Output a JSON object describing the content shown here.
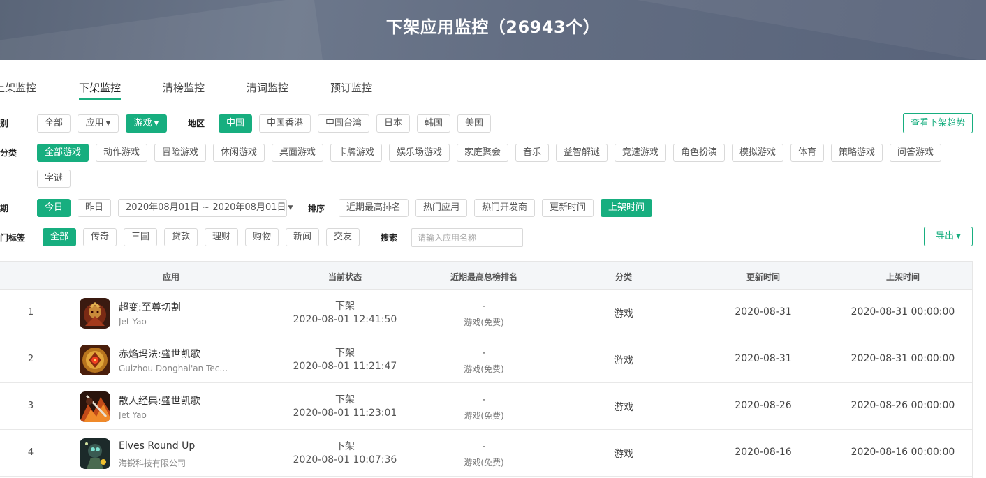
{
  "header": {
    "title": "下架应用监控（26943个）"
  },
  "tabs": [
    "上架监控",
    "下架监控",
    "清榜监控",
    "清词监控",
    "预订监控"
  ],
  "filters": {
    "category": {
      "label": "类别",
      "options": [
        "全部",
        "应用",
        "游戏"
      ],
      "selected": "游戏"
    },
    "region": {
      "label": "地区",
      "options": [
        "中国",
        "中国香港",
        "中国台湾",
        "日本",
        "韩国",
        "美国"
      ],
      "selected": "中国"
    },
    "trend_button": "查看下架趋势",
    "subcategory": {
      "label": "子分类",
      "options": [
        "全部游戏",
        "动作游戏",
        "冒险游戏",
        "休闲游戏",
        "桌面游戏",
        "卡牌游戏",
        "娱乐场游戏",
        "家庭聚会",
        "音乐",
        "益智解谜",
        "竞速游戏",
        "角色扮演",
        "模拟游戏",
        "体育",
        "策略游戏",
        "问答游戏",
        "字谜"
      ],
      "selected": "全部游戏"
    },
    "date": {
      "label": "日期",
      "options": [
        "今日",
        "昨日"
      ],
      "selected": "今日",
      "range": "2020年08月01日 ~ 2020年08月01日"
    },
    "sort": {
      "label": "排序",
      "options": [
        "近期最高排名",
        "热门应用",
        "热门开发商",
        "更新时间",
        "上架时间"
      ],
      "selected": "上架时间"
    },
    "tags": {
      "label": "热门标签",
      "options": [
        "全部",
        "传奇",
        "三国",
        "贷款",
        "理财",
        "购物",
        "新闻",
        "交友"
      ],
      "selected": "全部"
    },
    "search": {
      "label": "搜索",
      "placeholder": "请输入应用名称",
      "value": ""
    },
    "export_button": "导出"
  },
  "table": {
    "columns": [
      "应用",
      "当前状态",
      "近期最高总榜排名",
      "分类",
      "更新时间",
      "上架时间"
    ],
    "rows": [
      {
        "index": "1",
        "name": "超变:至尊切割",
        "developer": "Jet Yao",
        "status": "下架",
        "status_time": "2020-08-01 12:41:50",
        "rank": "-",
        "rank_sub": "游戏(免费)",
        "category": "游戏",
        "updated": "2020-08-31",
        "listed": "2020-08-31 00:00:00",
        "icon": "app-icon-warrior"
      },
      {
        "index": "2",
        "name": "赤焰玛法:盛世凯歌",
        "developer": "Guizhou Donghai'an Techn...",
        "status": "下架",
        "status_time": "2020-08-01 11:21:47",
        "rank": "-",
        "rank_sub": "游戏(免费)",
        "category": "游戏",
        "updated": "2020-08-31",
        "listed": "2020-08-31 00:00:00",
        "icon": "app-icon-emblem"
      },
      {
        "index": "3",
        "name": "散人经典:盛世凯歌",
        "developer": "Jet Yao",
        "status": "下架",
        "status_time": "2020-08-01 11:23:01",
        "rank": "-",
        "rank_sub": "游戏(免费)",
        "category": "游戏",
        "updated": "2020-08-26",
        "listed": "2020-08-26 00:00:00",
        "icon": "app-icon-fire-blade"
      },
      {
        "index": "4",
        "name": "Elves Round Up",
        "developer": "海锐科技有限公司",
        "status": "下架",
        "status_time": "2020-08-01 10:07:36",
        "rank": "-",
        "rank_sub": "游戏(免费)",
        "category": "游戏",
        "updated": "2020-08-16",
        "listed": "2020-08-16 00:00:00",
        "icon": "app-icon-elf"
      }
    ]
  },
  "colors": {
    "accent": "#17ae7f",
    "banner": "#626d82"
  }
}
